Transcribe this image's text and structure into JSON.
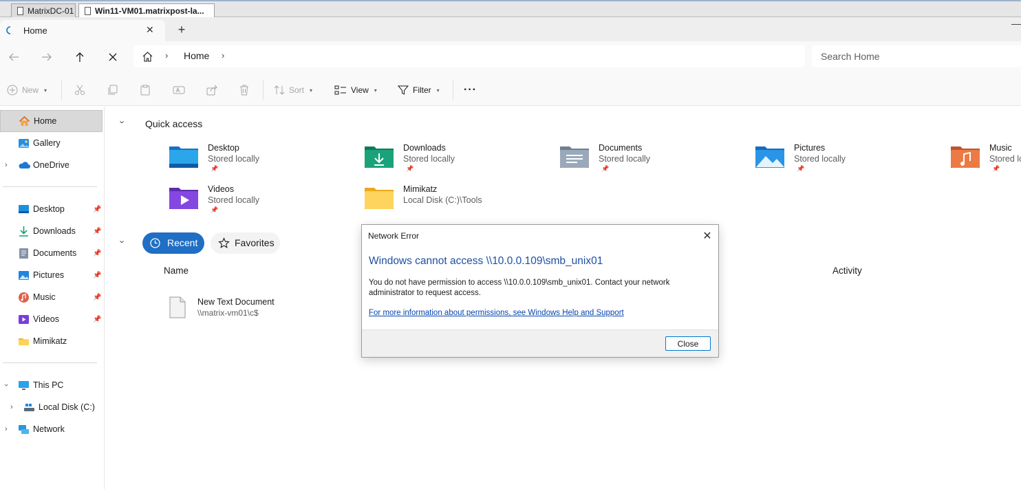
{
  "rdp": {
    "tabs": [
      {
        "label": "MatrixDC-01"
      },
      {
        "label": "Win11-VM01.matrixpost-la..."
      }
    ]
  },
  "explorer_tab": {
    "label": "Home",
    "close": "✕",
    "new_tab": "+"
  },
  "address": {
    "path": [
      "Home"
    ],
    "search_placeholder": "Search Home"
  },
  "commands": {
    "new": "New",
    "sort": "Sort",
    "view": "View",
    "filter": "Filter",
    "more": "···"
  },
  "sidebar": {
    "top": [
      {
        "label": "Home"
      },
      {
        "label": "Gallery"
      },
      {
        "label": "OneDrive"
      }
    ],
    "pinned": [
      {
        "label": "Desktop"
      },
      {
        "label": "Downloads"
      },
      {
        "label": "Documents"
      },
      {
        "label": "Pictures"
      },
      {
        "label": "Music"
      },
      {
        "label": "Videos"
      },
      {
        "label": "Mimikatz"
      }
    ],
    "bottom": [
      {
        "label": "This PC"
      },
      {
        "label": "Local Disk (C:)"
      },
      {
        "label": "Network"
      }
    ]
  },
  "quick_access": {
    "title": "Quick access",
    "items": [
      {
        "name": "Desktop",
        "sub": "Stored locally",
        "icon": "desktop-folder-icon"
      },
      {
        "name": "Downloads",
        "sub": "Stored locally",
        "icon": "downloads-folder-icon"
      },
      {
        "name": "Documents",
        "sub": "Stored locally",
        "icon": "documents-folder-icon"
      },
      {
        "name": "Pictures",
        "sub": "Stored locally",
        "icon": "pictures-folder-icon"
      },
      {
        "name": "Music",
        "sub": "Stored lo",
        "icon": "music-folder-icon"
      },
      {
        "name": "Videos",
        "sub": "Stored locally",
        "icon": "videos-folder-icon"
      },
      {
        "name": "Mimikatz",
        "sub": "Local Disk (C:)\\Tools",
        "icon": "folder-icon"
      }
    ]
  },
  "recent": {
    "tab_recent": "Recent",
    "tab_favorites": "Favorites",
    "col_name": "Name",
    "col_activity": "Activity",
    "files": [
      {
        "name": "New Text Document",
        "path": "\\\\matrix-vm01\\c$"
      }
    ]
  },
  "dialog": {
    "title": "Network Error",
    "heading": "Windows cannot access \\\\10.0.0.109\\smb_unix01",
    "message": "You do not have permission to access \\\\10.0.0.109\\smb_unix01. Contact your network administrator to request access.",
    "link": "For more information about permissions, see Windows Help and Support",
    "close_button": "Close"
  },
  "colors": {
    "accent": "#0078d4",
    "recent_pill": "#1f6fc5",
    "dialog_heading": "#1e4fa3"
  }
}
